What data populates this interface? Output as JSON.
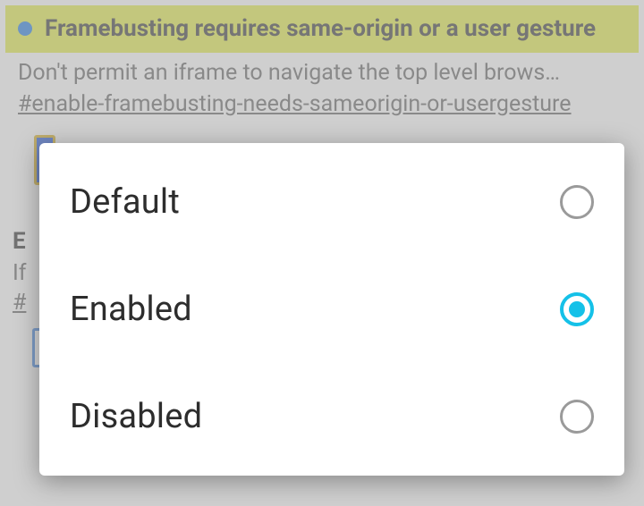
{
  "flags": [
    {
      "title": "Framebusting requires same-origin or a user gesture",
      "description": "Don't permit an iframe to navigate the top level brows…",
      "anchor": "#enable-framebusting-needs-sameorigin-or-usergesture",
      "highlighted": true
    },
    {
      "title_partial": "E",
      "description_partial": "If",
      "anchor_partial": "#"
    }
  ],
  "dialog": {
    "options": [
      {
        "label": "Default",
        "selected": false
      },
      {
        "label": "Enabled",
        "selected": true
      },
      {
        "label": "Disabled",
        "selected": false
      }
    ]
  }
}
